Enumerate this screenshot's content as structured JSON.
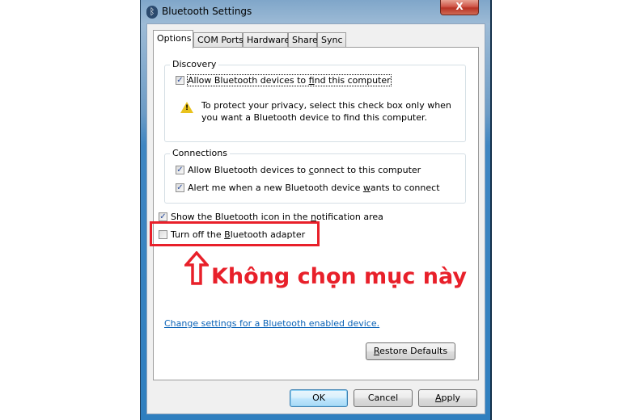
{
  "window": {
    "title": "Bluetooth Settings",
    "icon": "bluetooth-icon",
    "close_label": "X"
  },
  "tabs": [
    {
      "label": "Options",
      "active": true
    },
    {
      "label": "COM Ports",
      "active": false
    },
    {
      "label": "Hardware",
      "active": false
    },
    {
      "label": "Share",
      "active": false
    },
    {
      "label": "Sync",
      "active": false
    }
  ],
  "discovery": {
    "label": "Discovery",
    "allow_find": {
      "before": "Allow Bluetooth devices to ",
      "accel": "f",
      "after": "ind this computer",
      "checked": true
    },
    "warning_icon": "warning-icon",
    "warning_line1": "To protect your privacy, select this check box only when",
    "warning_line2": "you want a Bluetooth device to find this computer."
  },
  "connections": {
    "label": "Connections",
    "allow_connect": {
      "before": "Allow Bluetooth devices to ",
      "accel": "c",
      "after": "onnect to this computer",
      "checked": true
    },
    "alert_new": {
      "before": "Alert me when a new Bluetooth device ",
      "accel": "w",
      "after": "ants to connect",
      "checked": true
    }
  },
  "show_icon": {
    "before": "Show the Bluetooth icon in the ",
    "accel": "n",
    "after": "otification area",
    "checked": true
  },
  "turn_off": {
    "before": "Turn off the ",
    "accel": "B",
    "after": "luetooth adapter",
    "checked": false
  },
  "annotation": {
    "text": "Không chọn mục này",
    "color": "#e8202a",
    "arrow_icon": "up-arrow-icon"
  },
  "link": {
    "label": "Change settings for a Bluetooth enabled device."
  },
  "buttons": {
    "restore_accel": "R",
    "restore_rest": "estore Defaults",
    "ok": "OK",
    "cancel": "Cancel",
    "apply_accel": "A",
    "apply_rest": "pply"
  },
  "check_glyph": "✓"
}
